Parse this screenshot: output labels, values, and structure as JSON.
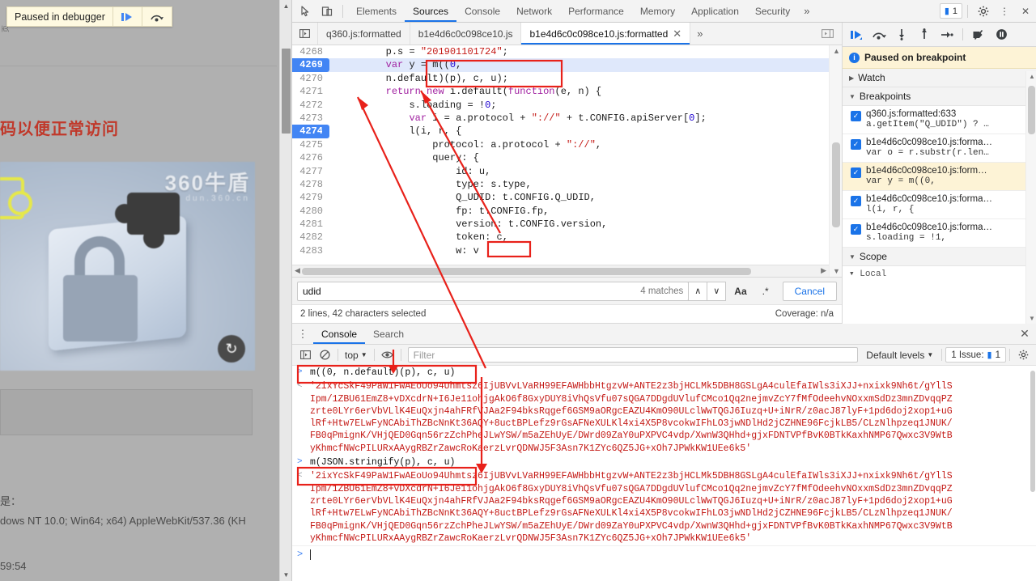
{
  "webpage": {
    "pause_banner": {
      "text": "Paused in debugger",
      "resume_icon": "resume-icon",
      "step_over_icon": "step-over-icon"
    },
    "partial_cjk": "页",
    "red_notice": "码以便正常访问",
    "captcha": {
      "brand_line1": "360牛盾",
      "brand_line2": "dun.360.cn",
      "plus_icon": "plus-circle-icon",
      "refresh_icon": "refresh-icon",
      "lock_icon": "lock-icon"
    },
    "text_lines": [
      "是：",
      "dows NT 10.0; Win64; x64) AppleWebKit/537.36 (KH",
      "59:54"
    ]
  },
  "devtools": {
    "toolbar": {
      "inspect_icon": "inspect-cursor-icon",
      "device_icon": "device-toolbar-icon",
      "tabs": [
        {
          "label": "Elements",
          "active": false
        },
        {
          "label": "Sources",
          "active": true
        },
        {
          "label": "Console",
          "active": false
        },
        {
          "label": "Network",
          "active": false
        },
        {
          "label": "Performance",
          "active": false
        },
        {
          "label": "Memory",
          "active": false
        },
        {
          "label": "Application",
          "active": false
        },
        {
          "label": "Security",
          "active": false
        }
      ],
      "more_tabs_icon": "chevron-double-right-icon",
      "issues_count": "1",
      "issues_icon": "message-icon",
      "settings_icon": "gear-icon",
      "kebab_icon": "vertical-dots-icon",
      "close_icon": "close-icon"
    },
    "file_tabs": {
      "navigator_toggle_icon": "show-navigator-icon",
      "items": [
        {
          "label": "q360.js:formatted",
          "active": false,
          "closable": false
        },
        {
          "label": "b1e4d6c0c098ce10.js",
          "active": false,
          "closable": false
        },
        {
          "label": "b1e4d6c0c098ce10.js:formatted",
          "active": true,
          "closable": true
        }
      ],
      "more_icon": "chevron-double-right-icon",
      "split_icon": "show-debugger-sidebar-icon"
    },
    "code": {
      "lines": [
        {
          "n": "4268",
          "breakpoint": false,
          "executing": false,
          "text": "        p.s = \"201901101724\";"
        },
        {
          "n": "4269",
          "breakpoint": true,
          "executing": true,
          "text": "        var y = m((0,"
        },
        {
          "n": "4270",
          "breakpoint": false,
          "executing": false,
          "text": "        n.default)(p), c, u);"
        },
        {
          "n": "4271",
          "breakpoint": false,
          "executing": false,
          "text": "        return new i.default(function(e, n) {"
        },
        {
          "n": "4272",
          "breakpoint": false,
          "executing": false,
          "text": "            s.loading = !0;"
        },
        {
          "n": "4273",
          "breakpoint": false,
          "executing": false,
          "text": "            var i = a.protocol + \"://\" + t.CONFIG.apiServer[0];"
        },
        {
          "n": "4274",
          "breakpoint": true,
          "executing": false,
          "text": "            l(i, r, {"
        },
        {
          "n": "4275",
          "breakpoint": false,
          "executing": false,
          "text": "                protocol: a.protocol + \"://\","
        },
        {
          "n": "4276",
          "breakpoint": false,
          "executing": false,
          "text": "                query: {"
        },
        {
          "n": "4277",
          "breakpoint": false,
          "executing": false,
          "text": "                    id: u,"
        },
        {
          "n": "4278",
          "breakpoint": false,
          "executing": false,
          "text": "                    type: s.type,"
        },
        {
          "n": "4279",
          "breakpoint": false,
          "executing": false,
          "text": "                    Q_UDID: t.CONFIG.Q_UDID,"
        },
        {
          "n": "4280",
          "breakpoint": false,
          "executing": false,
          "text": "                    fp: t.CONFIG.fp,"
        },
        {
          "n": "4281",
          "breakpoint": false,
          "executing": false,
          "text": "                    version: t.CONFIG.version,"
        },
        {
          "n": "4282",
          "breakpoint": false,
          "executing": false,
          "text": "                    token: c,"
        },
        {
          "n": "4283",
          "breakpoint": false,
          "executing": false,
          "text": "                    w: v"
        }
      ]
    },
    "search": {
      "value": "udid",
      "placeholder": "Search",
      "matches": "4 matches",
      "prev_icon": "chevron-up-icon",
      "next_icon": "chevron-down-icon",
      "match_case_label": "Aa",
      "regex_label": ".*",
      "cancel_label": "Cancel"
    },
    "status": {
      "selection": "2 lines, 42 characters selected",
      "coverage": "Coverage: n/a"
    },
    "drawer": {
      "kebab_icon": "vertical-dots-icon",
      "tabs": [
        {
          "label": "Console",
          "active": true
        },
        {
          "label": "Search",
          "active": false
        }
      ],
      "close_icon": "close-icon",
      "console_toolbar": {
        "sidebar_icon": "console-sidebar-icon",
        "clear_icon": "clear-console-icon",
        "context": "top",
        "eye_icon": "live-expression-icon",
        "filter_placeholder": "Filter",
        "levels": "Default levels",
        "issues_label": "1 Issue:",
        "issues_count": "1",
        "issues_icon": "message-icon",
        "settings_icon": "gear-icon"
      },
      "entries": [
        {
          "kind": "input",
          "marker": ">",
          "text": "m((0, n.default)(p), c, u)"
        },
        {
          "kind": "output",
          "marker": "<",
          "segments": [
            "'2ixYcSkF49PaW1FwAEoUo94Uhmtsz6IjUBVvLVaRH99EFAWHbbHtgzvW+ANTE2z3bjHCLMk5DBH8GSLgA4culEfaIWls3iXJJ+nxixk9Nh6t/gYllS",
            "Ipm/1ZBU61EmZ8+vDXcdrN+I6Je11ohjgAkO6f8GxyDUY8iVhQsVfu07sQGA7DDgdUVlufCMco1Qq2nejmvZcY7fMfOdeehvNOxxmSdDz3mnZDvqqPZ",
            "zrte0LYr6erVbVLlK4EuQxjn4ahFRfVJAa2F94bksRqgef6GSM9aORgcEAZU4KmO90ULclWwTQGJ6Iuzq+U+iNrR/z0acJ87lyF+1pd6doj2xop1+uG",
            "lRf+Htw7ELwFyNCAbiThZBcNnKt36AQY+8uctBPLefz9rGsAFNeXULKl4xi4X5P8vcokwIFhLO3jwNDlHd2jCZHNE96FcjkLB5/CLzNlhpzeq1JNUK/",
            "FB0qPmignK/VHjQED0Gqn56rzZchPheJLwYSW/m5aZEhUyE/DWrd09ZaY0uPXPVC4vdp/XwnW3QHhd+gjxFDNTVPfBvK0BTkKaxhNMP67Qwxc3V9WtB",
            "yKhmcfNWcPILURxAAygRBZrZawcRoKaerzLvrQDNWJ5F3Asn7K1ZYc6QZ5JG+xOh7JPWkKW1UEe6k5'"
          ]
        },
        {
          "kind": "input",
          "marker": ">",
          "text": "m(JSON.stringify(p), c, u)"
        },
        {
          "kind": "output",
          "marker": "<",
          "segments": [
            "'2ixYcSkF49PaW1FwAEoUo94Uhmtsz6IjUBVvLVaRH99EFAWHbbHtgzvW+ANTE2z3bjHCLMk5DBH8GSLgA4culEfaIWls3iXJJ+nxixk9Nh6t/gYllS",
            "Ipm/1ZBU61EmZ8+vDXcdrN+I6Je11ohjgAkO6f8GxyDUY8iVhQsVfu07sQGA7DDgdUVlufCMco1Qq2nejmvZcY7fMfOdeehvNOxxmSdDz3mnZDvqqPZ",
            "zrte0LYr6erVbVLlK4EuQxjn4ahFRfVJAa2F94bksRqgef6GSM9aORgcEAZU4KmO90ULclWwTQGJ6Iuzq+U+iNrR/z0acJ87lyF+1pd6doj2xop1+uG",
            "lRf+Htw7ELwFyNCAbiThZBcNnKt36AQY+8uctBPLefz9rGsAFNeXULKl4xi4X5P8vcokwIFhLO3jwNDlHd2jCZHNE96FcjkLB5/CLzNlhpzeq1JNUK/",
            "FB0qPmignK/VHjQED0Gqn56rzZchPheJLwYSW/m5aZEhUyE/DWrd09ZaY0uPXPVC4vdp/XwnW3QHhd+gjxFDNTVPfBvK0BTkKaxhNMP67Qwxc3V9WtB",
            "yKhmcfNWcPILURxAAygRBZrZawcRoKaerzLvrQDNWJ5F3Asn7K1ZYc6QZ5JG+xOh7JPWkKW1UEe6k5'"
          ]
        }
      ],
      "prompt_marker": ">"
    },
    "sidebar": {
      "debug_toolbar": {
        "resume_icon": "resume-script-icon",
        "step_over_icon": "step-over-icon",
        "step_into_icon": "step-into-icon",
        "step_out_icon": "step-out-icon",
        "step_icon": "step-icon",
        "deactivate_breakpoints_icon": "deactivate-breakpoints-icon",
        "pause_on_exceptions_icon": "pause-on-exceptions-icon"
      },
      "paused_banner": "Paused on breakpoint",
      "sections": [
        {
          "label": "Watch",
          "expanded": false
        },
        {
          "label": "Breakpoints",
          "expanded": true
        }
      ],
      "breakpoints": [
        {
          "location": "q360.js:formatted:633",
          "code": "a.getItem(\"Q_UDID\") ? …",
          "checked": true,
          "active": false
        },
        {
          "location": "b1e4d6c0c098ce10.js:forma…",
          "code": "var o = r.substr(r.len…",
          "checked": true,
          "active": false
        },
        {
          "location": "b1e4d6c0c098ce10.js:form…",
          "code": "var y = m((0,",
          "checked": true,
          "active": true
        },
        {
          "location": "b1e4d6c0c098ce10.js:forma…",
          "code": "l(i, r, {",
          "checked": true,
          "active": false
        },
        {
          "location": "b1e4d6c0c098ce10.js:forma…",
          "code": "s.loading = !1,",
          "checked": true,
          "active": false
        }
      ],
      "scope_label": "Scope",
      "scope_tail": "▾ Local"
    }
  }
}
